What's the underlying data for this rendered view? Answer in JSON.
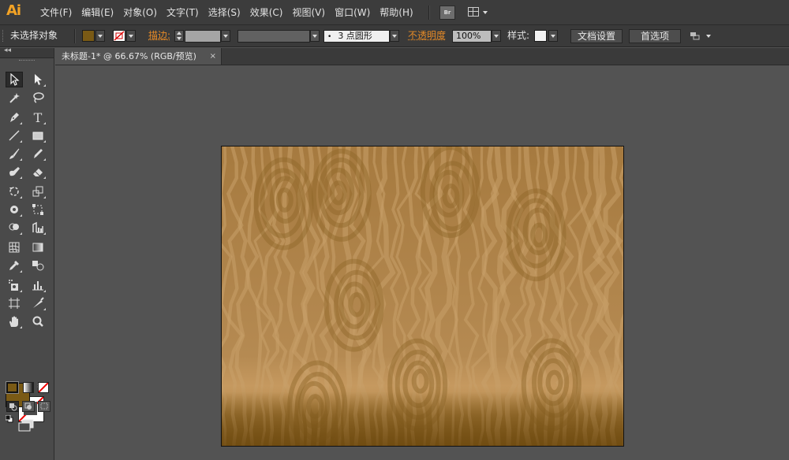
{
  "app": {
    "logo": "Ai"
  },
  "menu": {
    "items": [
      "文件(F)",
      "编辑(E)",
      "对象(O)",
      "文字(T)",
      "选择(S)",
      "效果(C)",
      "视图(V)",
      "窗口(W)",
      "帮助(H)"
    ],
    "bridge_label": "Br"
  },
  "control_bar": {
    "selection_status": "未选择对象",
    "stroke_label": "描边:",
    "stroke_profile": "3 点圆形",
    "opacity_label": "不透明度",
    "opacity_value": "100%",
    "style_label": "样式:",
    "doc_setup_button": "文档设置",
    "preferences_button": "首选项",
    "colors": {
      "fill": "#7a5a15",
      "accent": "#e58a27"
    }
  },
  "tools_panel": {
    "collapse_glyph": "◂◂",
    "tools": [
      "selection-tool",
      "direct-selection-tool",
      "magic-wand-tool",
      "lasso-tool",
      "pen-tool",
      "type-tool",
      "line-segment-tool",
      "rectangle-tool",
      "paintbrush-tool",
      "pencil-tool",
      "blob-brush-tool",
      "eraser-tool",
      "rotate-tool",
      "scale-tool",
      "warp-tool",
      "free-transform-tool",
      "shape-builder-tool",
      "perspective-grid-tool",
      "mesh-tool",
      "gradient-tool",
      "eyedropper-tool",
      "blend-tool",
      "symbol-sprayer-tool",
      "column-graph-tool",
      "artboard-tool",
      "slice-tool",
      "hand-tool",
      "zoom-tool"
    ],
    "fill_color": "#7a5a15",
    "stroke_color": "none"
  },
  "document": {
    "tab_title": "未标题-1* @ 66.67% (RGB/预览)",
    "close_glyph": "×",
    "artboard_colors": {
      "base": "#a57c44",
      "stripe": "#c49a5f",
      "dark": "#80591e"
    }
  }
}
